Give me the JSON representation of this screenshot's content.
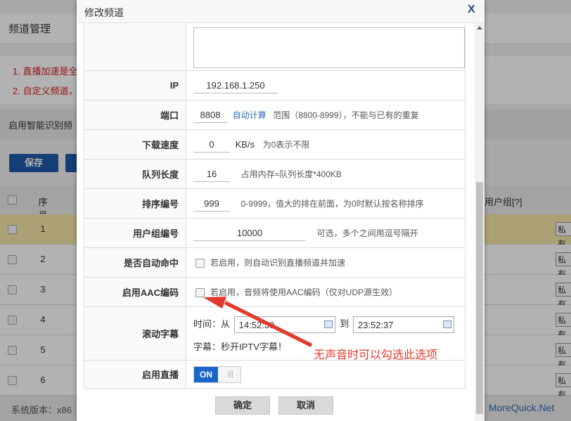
{
  "background": {
    "page_title": "频道管理",
    "notes": [
      "1. 直播加速是全",
      "2. 自定义频道，"
    ],
    "smart_switch_label": "启用智能识别频",
    "save_button": "保存",
    "second_button": "",
    "table_header": {
      "index": "序号",
      "user_group": "用户组[?]"
    },
    "rows": [
      "1",
      "2",
      "3",
      "4",
      "5",
      "6"
    ],
    "side_button_label": "私有",
    "version_label": "系统版本：x86",
    "brand": "MoreQuick.Net"
  },
  "dialog": {
    "title": "修改频道",
    "close_icon": "close-icon",
    "fields": {
      "ip": {
        "label": "IP",
        "value": "192.168.1.250"
      },
      "port": {
        "label": "端口",
        "value": "8808",
        "auto_link": "自动计算",
        "hint": "范围（8800-8999），不能与已有的重复"
      },
      "download_speed": {
        "label": "下载速度",
        "value": "0",
        "unit": "KB/s",
        "hint": "为0表示不限"
      },
      "queue_length": {
        "label": "队列长度",
        "value": "16",
        "hint": "占用内存≈队列长度*400KB"
      },
      "sort_number": {
        "label": "排序编号",
        "value": "999",
        "hint": "0-9999，值大的排在前面，为0时默认按名称排序"
      },
      "user_group": {
        "label": "用户组编号",
        "value": "10000",
        "hint": "可选，多个之间用逗号隔开"
      },
      "auto_hit": {
        "label": "是否自动命中",
        "checked": false,
        "hint": "若启用，则自动识别直播频道并加速"
      },
      "aac": {
        "label": "启用AAC编码",
        "checked": false,
        "hint": "若启用，音频将使用AAC编码（仅对UDP源生效）"
      },
      "ticker": {
        "label": "滚动字幕",
        "time_label": "时间：从",
        "from": "14:52:30",
        "to_label": "到",
        "to": "23:52:37",
        "text_label": "字幕：秒开IPTV字幕！"
      },
      "live": {
        "label": "启用直播",
        "toggle": "ON",
        "toggle_off_glyph": "|||"
      }
    },
    "buttons": {
      "confirm": "确定",
      "cancel": "取消"
    }
  },
  "annotation": {
    "text": "无声音时可以勾选此选项",
    "color": "#e23a2e"
  },
  "colors": {
    "accent": "#1a66c7",
    "dialog_title_close": "#2a4a7f",
    "note_red": "#d9221c",
    "row_highlight": "#f5e7a6"
  }
}
